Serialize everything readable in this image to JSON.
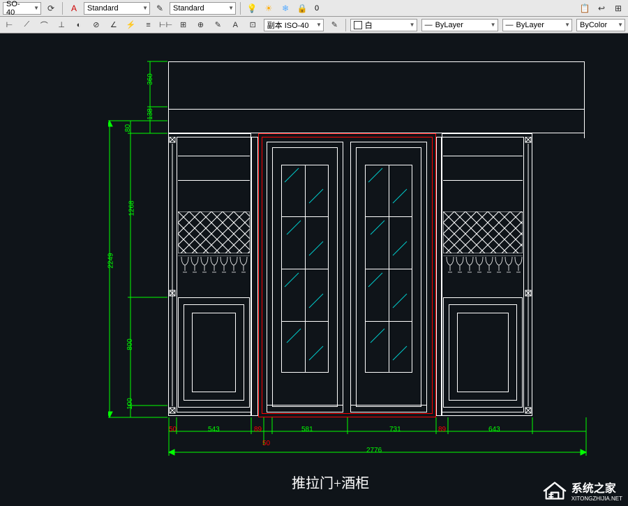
{
  "toolbar1": {
    "dimstyle1": "SO-40",
    "textstyle1": "Standard",
    "textstyle2": "Standard",
    "layers_text": "0"
  },
  "toolbar2": {
    "dimstyle_copy": "副本 ISO-40",
    "color_label": "白",
    "linetype1": "ByLayer",
    "linetype2": "ByLayer",
    "plotstyle": "ByColor"
  },
  "dimensions": {
    "v_360": "360",
    "v_138": "138",
    "v_80": "80",
    "v_1268": "1268",
    "v_2249": "2249",
    "v_800": "800",
    "v_100": "100",
    "h_50": "50",
    "h_543": "543",
    "h_89_1": "89",
    "h_50_2": "50",
    "h_581": "581",
    "h_731": "731",
    "h_89_2": "89",
    "h_643": "643",
    "h_total": "2776"
  },
  "title": "推拉门+酒柜",
  "watermark": {
    "name": "系统之家",
    "url": "XITONGZHIJIA.NET"
  }
}
